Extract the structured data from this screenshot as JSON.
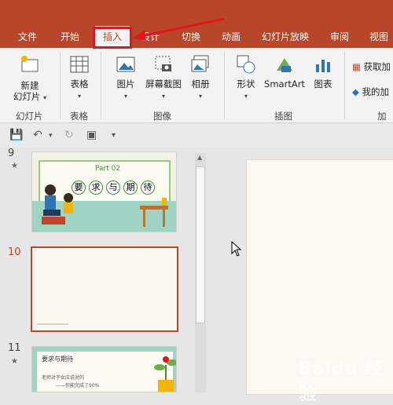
{
  "tabs": [
    "文件",
    "开始",
    "插入",
    "设计",
    "切换",
    "动画",
    "幻灯片放映",
    "审阅",
    "视图"
  ],
  "active_tab": "插入",
  "ribbon": {
    "new_slide": "新建\n幻灯片",
    "table": "表格",
    "picture": "图片",
    "screenshot": "屏幕截图",
    "album": "相册",
    "shapes": "形状",
    "smartart": "SmartArt",
    "chart": "图表",
    "get_addins": "获取加",
    "my_addins": "我的加"
  },
  "groups": {
    "slides": "幻灯片",
    "tables": "表格",
    "images": "图像",
    "illustrations": "插图",
    "addins": "加载"
  },
  "thumbnails": [
    {
      "number": "9",
      "title": "Part 02",
      "subtitle": [
        "要",
        "求",
        "与",
        "期",
        "待"
      ]
    },
    {
      "number": "10"
    },
    {
      "number": "11",
      "heading": "要求与期待",
      "line1": "老师对子女应说对的",
      "line2": "——你能完成了90%"
    }
  ],
  "colors": {
    "accent": "#b8462a",
    "selected_border": "#c0452b",
    "annotation": "#e0161e"
  },
  "watermark": "Baidu 经验"
}
